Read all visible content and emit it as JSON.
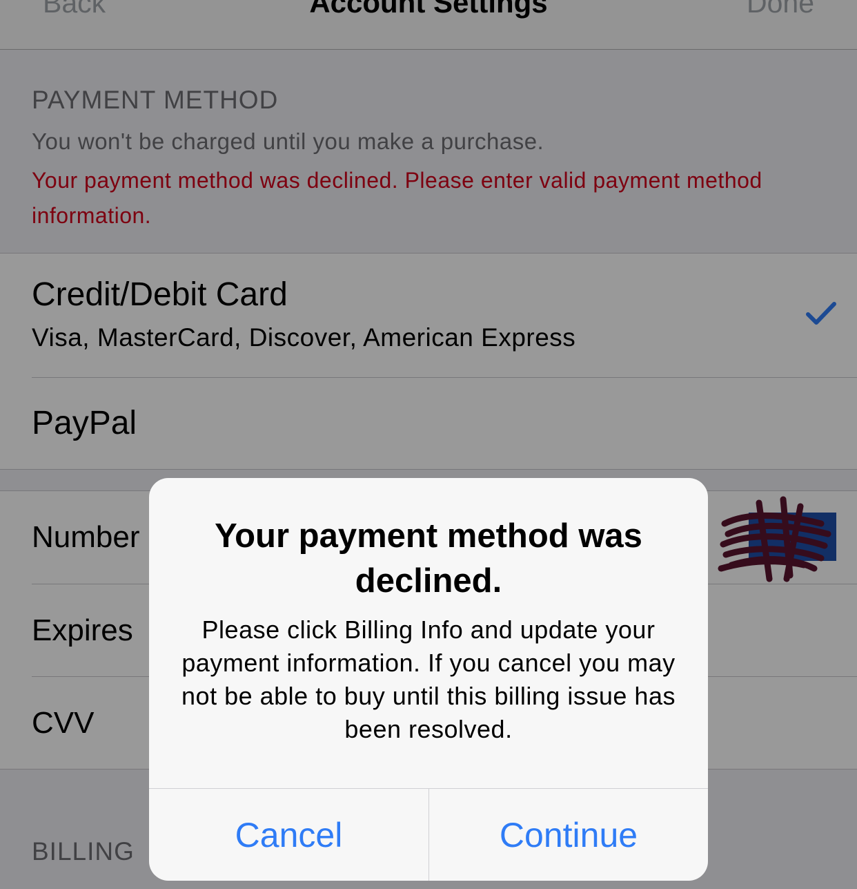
{
  "nav": {
    "back_label": "Back",
    "title": "Account Settings",
    "done_label": "Done"
  },
  "payment_section": {
    "title": "PAYMENT METHOD",
    "subtitle": "You won't be charged until you make a purchase.",
    "error": "Your payment method was declined. Please enter valid payment method information."
  },
  "payment_options": [
    {
      "title": "Credit/Debit Card",
      "subtitle": "Visa, MasterCard, Discover, American Express",
      "selected": true
    },
    {
      "title": "PayPal",
      "selected": false
    }
  ],
  "card_fields": [
    {
      "label": "Number"
    },
    {
      "label": "Expires"
    },
    {
      "label": "CVV"
    }
  ],
  "billing_section": {
    "title": "BILLING"
  },
  "alert": {
    "title": "Your payment method was declined.",
    "message": "Please click Billing Info and update your payment information. If you cancel you may not be able to buy until this billing issue has been resolved.",
    "cancel_label": "Cancel",
    "continue_label": "Continue"
  },
  "colors": {
    "accent": "#2f7cf6",
    "error": "#d0021b"
  },
  "icons": {
    "selected_indicator": "checkmark-icon"
  }
}
